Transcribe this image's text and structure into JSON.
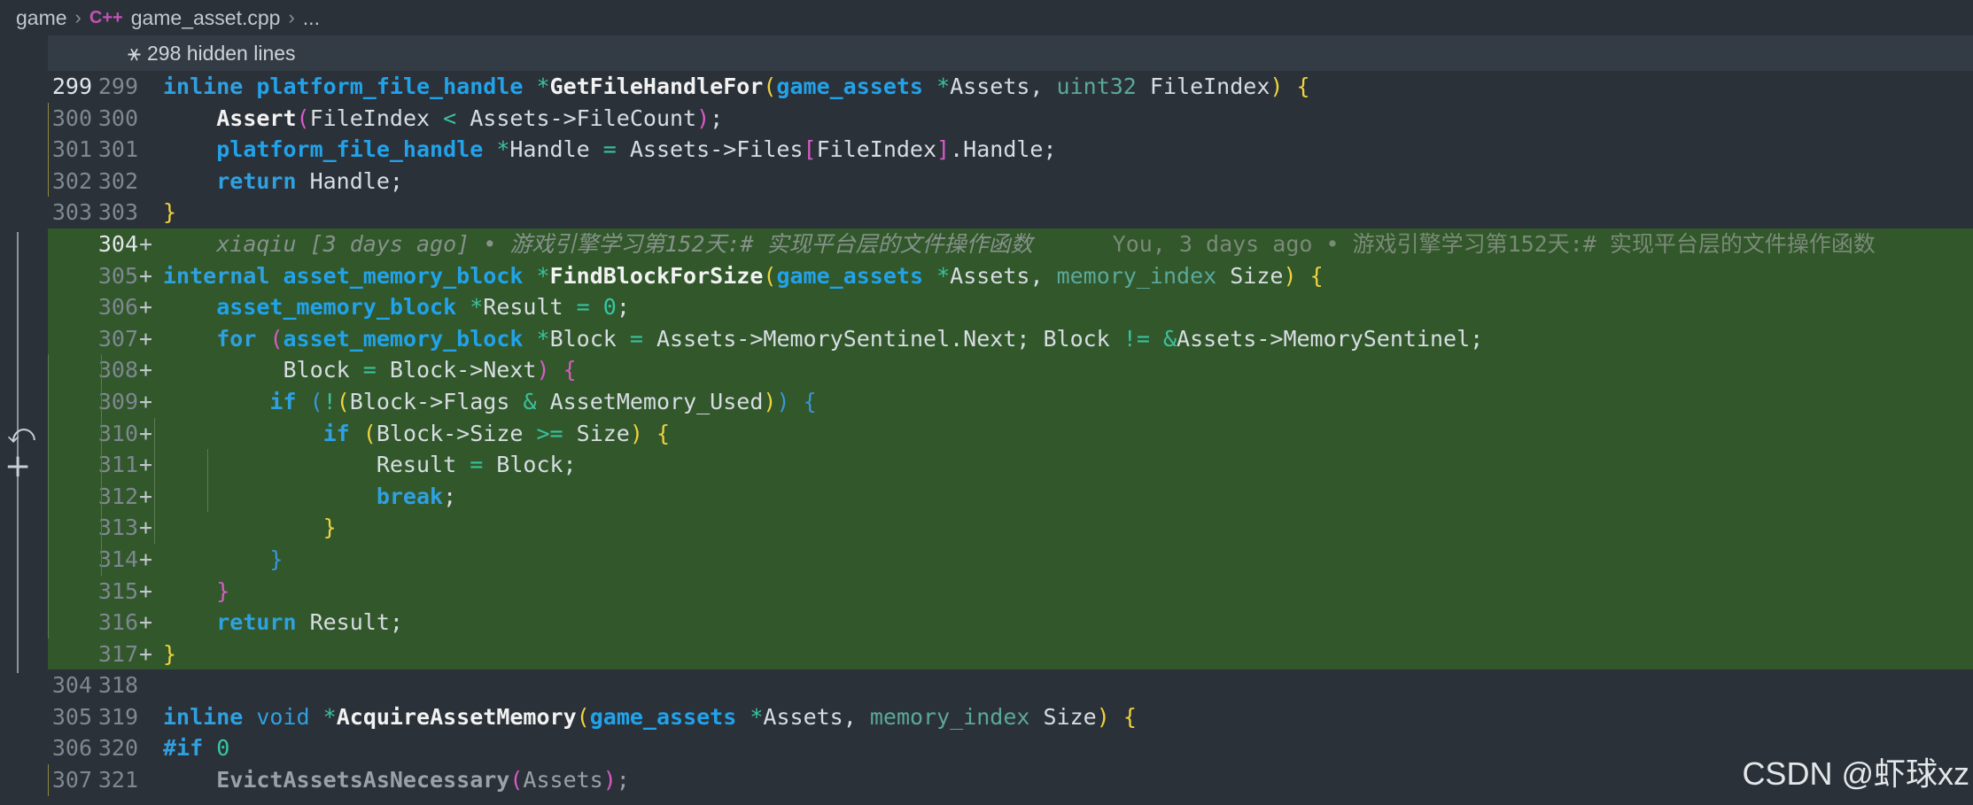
{
  "breadcrumb": {
    "root": "game",
    "lang_icon": "C++",
    "file": "game_asset.cpp",
    "more": "..."
  },
  "hidden": {
    "icon": "unfold-icon",
    "label": "298 hidden lines"
  },
  "blame": {
    "author_line": "xiaqiu [3 days ago] • 游戏引擎学习第152天:# 实现平台层的文件操作函数",
    "inline": "You, 3 days ago • 游戏引擎学习第152天:# 实现平台层的文件操作函数"
  },
  "watermark": "CSDN @虾球xz",
  "colors": {
    "added_bg": "#31572b",
    "editor_bg": "#2b3138",
    "keyword": "#2fa0e0"
  },
  "lines": [
    {
      "old": "299",
      "new": "299",
      "marker": ""
    },
    {
      "old": "300",
      "new": "300",
      "marker": ""
    },
    {
      "old": "301",
      "new": "301",
      "marker": ""
    },
    {
      "old": "302",
      "new": "302",
      "marker": ""
    },
    {
      "old": "303",
      "new": "303",
      "marker": ""
    },
    {
      "old": "",
      "new": "304",
      "marker": "+"
    },
    {
      "old": "",
      "new": "305",
      "marker": "+"
    },
    {
      "old": "",
      "new": "306",
      "marker": "+"
    },
    {
      "old": "",
      "new": "307",
      "marker": "+"
    },
    {
      "old": "",
      "new": "308",
      "marker": "+"
    },
    {
      "old": "",
      "new": "309",
      "marker": "+"
    },
    {
      "old": "",
      "new": "310",
      "marker": "+"
    },
    {
      "old": "",
      "new": "311",
      "marker": "+"
    },
    {
      "old": "",
      "new": "312",
      "marker": "+"
    },
    {
      "old": "",
      "new": "313",
      "marker": "+"
    },
    {
      "old": "",
      "new": "314",
      "marker": "+"
    },
    {
      "old": "",
      "new": "315",
      "marker": "+"
    },
    {
      "old": "",
      "new": "316",
      "marker": "+"
    },
    {
      "old": "",
      "new": "317",
      "marker": "+"
    },
    {
      "old": "304",
      "new": "318",
      "marker": ""
    },
    {
      "old": "305",
      "new": "319",
      "marker": ""
    },
    {
      "old": "306",
      "new": "320",
      "marker": ""
    },
    {
      "old": "307",
      "new": "321",
      "marker": ""
    }
  ],
  "code": {
    "l299": {
      "kw": "inline",
      "t1": "platform_file_handle",
      "star": "*",
      "fn": "GetFileHandleFor",
      "p1": "(",
      "t2": "game_assets",
      "star2": "*",
      "a1": "Assets, ",
      "t3": "uint32",
      "a2": " FileIndex",
      "p2": ")",
      "br": "{"
    },
    "l300": {
      "fn": "Assert",
      "p1": "(",
      "a": "FileIndex ",
      "op": "<",
      "b": " Assets->FileCount",
      "p2": ")",
      "end": ";"
    },
    "l301": {
      "t": "platform_file_handle",
      "star": "*",
      "a": "Handle ",
      "eq": "=",
      "b": " Assets->Files",
      "bk1": "[",
      "c": "FileIndex",
      "bk2": "]",
      "d": ".Handle;"
    },
    "l302": {
      "kw": "return",
      "a": " Handle;"
    },
    "l303": {
      "br": "}"
    },
    "l305": {
      "kw": "internal",
      "t": "asset_memory_block",
      "star": "*",
      "fn": "FindBlockForSize",
      "p1": "(",
      "t2": "game_assets",
      "star2": "*",
      "a": "Assets, ",
      "t3": "memory_index",
      "b": " Size",
      "p2": ")",
      "br": "{"
    },
    "l306": {
      "t": "asset_memory_block",
      "star": "*",
      "a": "Result ",
      "eq": "=",
      "num": "0",
      "end": ";"
    },
    "l307": {
      "kw": "for",
      "p1": "(",
      "t": "asset_memory_block",
      "star": "*",
      "a": "Block ",
      "eq": "=",
      "b": " Assets->MemorySentinel.Next; Block ",
      "ne": "!=",
      "amp": "&",
      "c": "Assets->MemorySentinel;"
    },
    "l308": {
      "a": "Block ",
      "eq": "=",
      "b": " Block->Next",
      "p2": ")",
      "br": "{"
    },
    "l309": {
      "kw": "if",
      "p1": "(",
      "not": "!",
      "p3": "(",
      "a": "Block->Flags ",
      "amp": "&",
      "b": " AssetMemory_Used",
      "p4": ")",
      "p2": ")",
      "br": "{"
    },
    "l310": {
      "kw": "if",
      "p1": "(",
      "a": "Block->Size ",
      "ge": ">=",
      "b": " Size",
      "p2": ")",
      "br": "{"
    },
    "l311": {
      "a": "Result ",
      "eq": "=",
      "b": " Block;"
    },
    "l312": {
      "kw": "break",
      "end": ";"
    },
    "l313": {
      "br": "}"
    },
    "l314": {
      "br": "}"
    },
    "l315": {
      "br": "}"
    },
    "l316": {
      "kw": "return",
      "a": " Result;"
    },
    "l317": {
      "br": "}"
    },
    "l318": {},
    "l319": {
      "kw": "inline",
      "t1": "void",
      "star": "*",
      "fn": "AcquireAssetMemory",
      "p1": "(",
      "t2": "game_assets",
      "star2": "*",
      "a": "Assets, ",
      "t3": "memory_index",
      "b": " Size",
      "p2": ")",
      "br": "{"
    },
    "l320": {
      "pp": "#if",
      "num": "0"
    },
    "l321": {
      "fn": "EvictAssetsAsNecessary",
      "p1": "(",
      "a": "Assets",
      "p2": ")",
      "end": ";"
    }
  }
}
